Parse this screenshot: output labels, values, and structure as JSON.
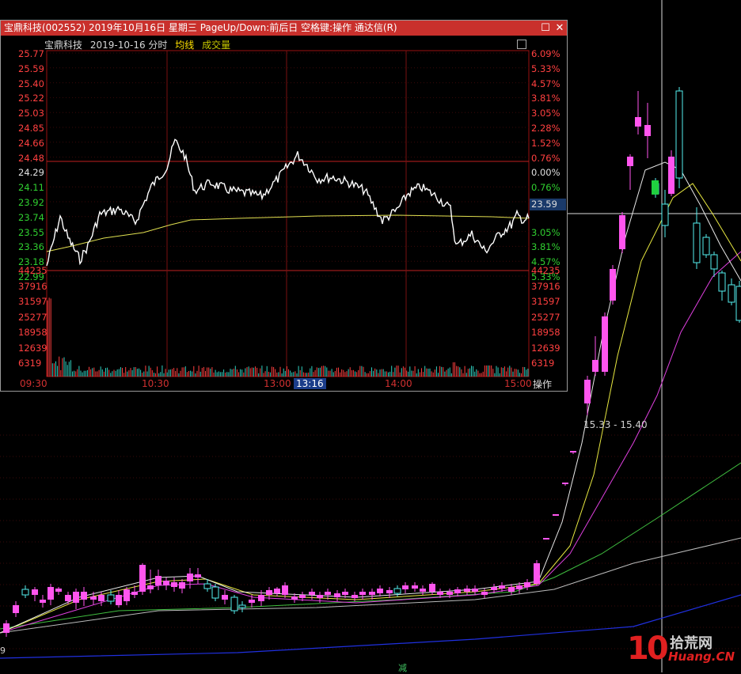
{
  "window": {
    "title": "宝鼎科技(002552) 2019年10月16日 星期三 PageUp/Down:前后日 空格键:操作 通达信(R)",
    "maximize_symbol": "☐",
    "close_symbol": "✕"
  },
  "infobar": {
    "stock_name": "宝鼎科技",
    "date_label": "2019-10-16 分时",
    "avg_line_label": "均线",
    "volume_label": "成交量"
  },
  "price_axis": [
    "25.77",
    "25.59",
    "25.40",
    "25.22",
    "25.03",
    "24.85",
    "24.66",
    "24.48",
    "24.29",
    "24.11",
    "23.92",
    "23.74",
    "23.55",
    "23.36",
    "23.18",
    "22.99"
  ],
  "pct_axis": [
    "6.09%",
    "5.33%",
    "4.57%",
    "3.81%",
    "3.05%",
    "2.28%",
    "1.52%",
    "0.76%",
    "0.00%",
    "0.76%",
    "1.52%",
    "",
    "3.05%",
    "3.81%",
    "4.57%",
    "5.33%"
  ],
  "volume_axis": [
    "44235",
    "37916",
    "31597",
    "25277",
    "18958",
    "12639",
    "6319"
  ],
  "current_price": "23.59",
  "time_axis": [
    "09:30",
    "10:30",
    "13:00",
    "13:16",
    "14:00",
    "15:00"
  ],
  "operate_button": "操作",
  "kline": {
    "range_label": "15.33 - 15.40",
    "reduce_label": "减",
    "left_edge_digit": "9"
  },
  "watermark": {
    "number": "10",
    "brand_cn": "拾荒网",
    "url": "Huang.CN"
  },
  "colors": {
    "up": "#ff55ee",
    "down": "#55f0f0",
    "bg": "#000000",
    "titlebar": "#c9302c",
    "grid_red": "#7a1010",
    "price_line": "#ffffff",
    "avg_line": "#e0e050",
    "ma_white": "#e8e8e8",
    "ma_yellow": "#e8e840",
    "ma_magenta": "#e040e0",
    "ma_green": "#40c040",
    "ma_gray": "#bbbbbb",
    "ma_blue": "#2030e0"
  }
}
